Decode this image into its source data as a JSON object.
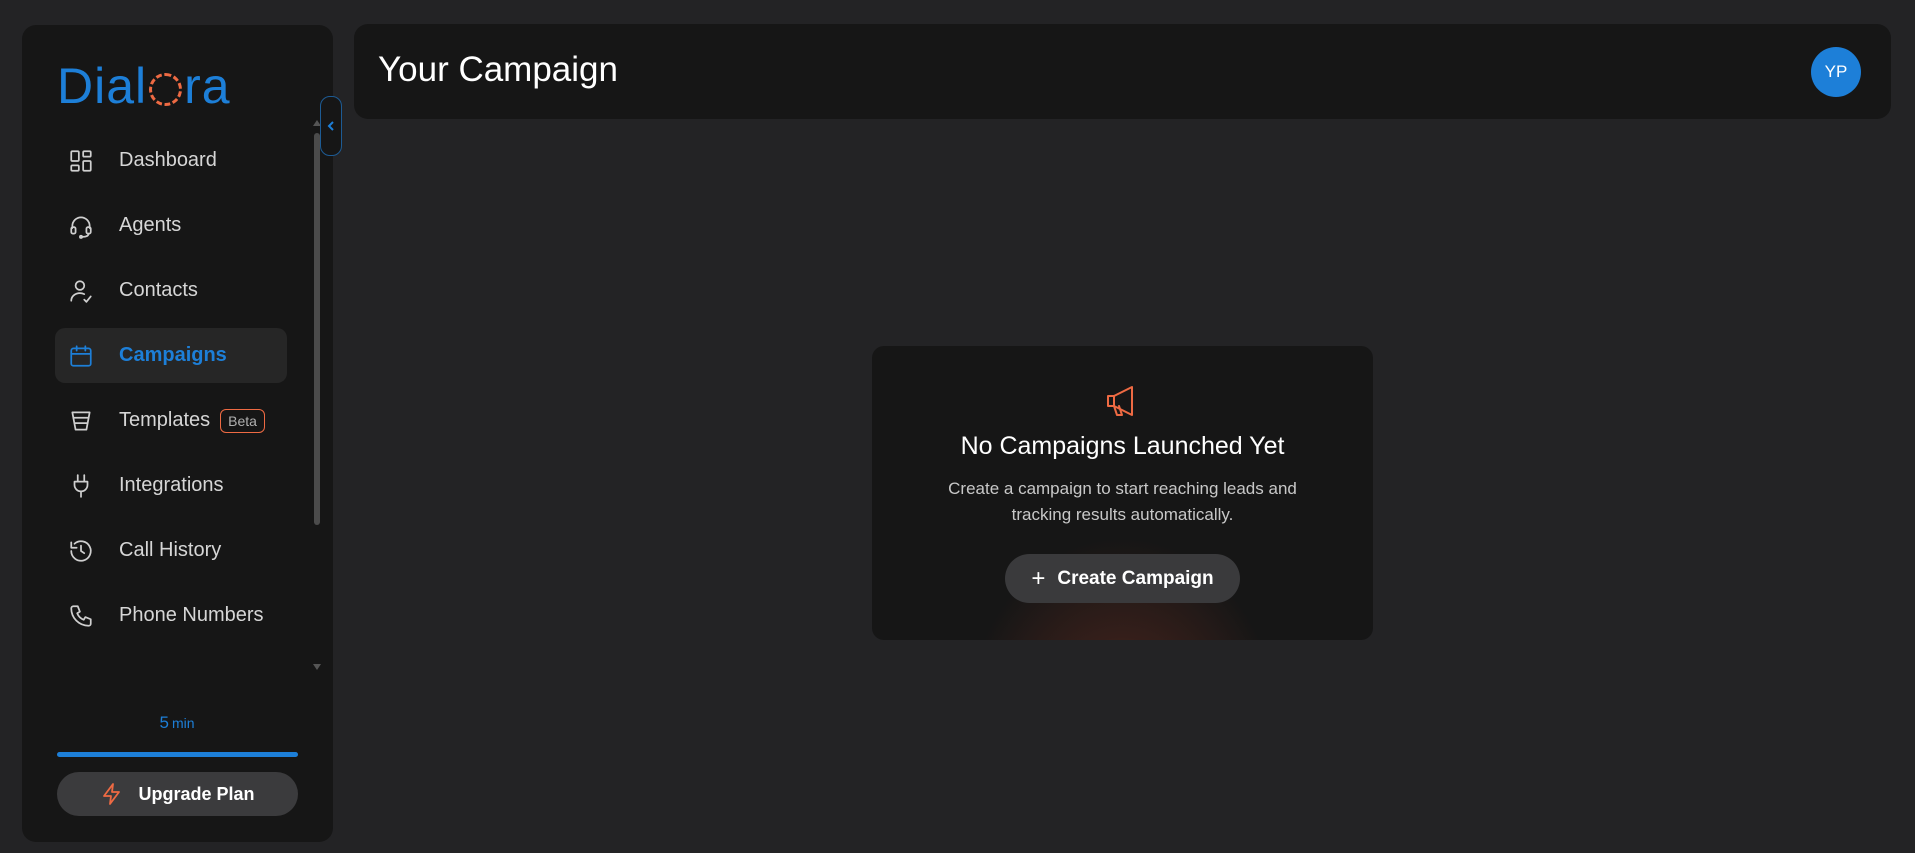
{
  "brand": {
    "logo_prefix": "Dial",
    "logo_suffix": "ra",
    "accent": "#1d7fd8",
    "secondary": "#ee6a43"
  },
  "sidebar": {
    "items": [
      {
        "label": "Dashboard",
        "icon": "dashboard-grid-icon",
        "active": false
      },
      {
        "label": "Agents",
        "icon": "headset-icon",
        "active": false
      },
      {
        "label": "Contacts",
        "icon": "user-icon",
        "active": false
      },
      {
        "label": "Campaigns",
        "icon": "calendar-icon",
        "active": true
      },
      {
        "label": "Templates",
        "icon": "funnel-icon",
        "active": false,
        "badge": "Beta"
      },
      {
        "label": "Integrations",
        "icon": "plug-icon",
        "active": false
      },
      {
        "label": "Call History",
        "icon": "history-icon",
        "active": false
      },
      {
        "label": "Phone Numbers",
        "icon": "phone-icon",
        "active": false
      }
    ],
    "usage": {
      "value": "5",
      "unit": "min",
      "progress_fraction": 1.0
    },
    "upgrade_label": "Upgrade Plan"
  },
  "header": {
    "title": "Your Campaign",
    "avatar_initials": "YP"
  },
  "empty_state": {
    "title": "No Campaigns Launched Yet",
    "description": "Create a campaign to start reaching leads and tracking results automatically.",
    "button_label": "Create Campaign",
    "icon": "megaphone-icon"
  }
}
